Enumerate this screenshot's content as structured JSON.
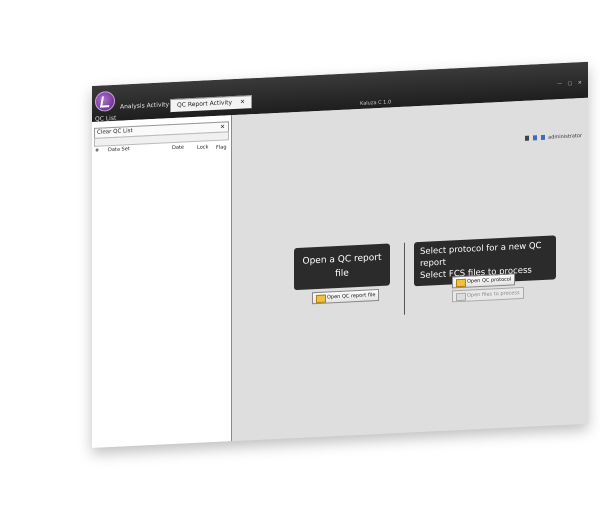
{
  "app": {
    "title": "Kaluza C 1.0"
  },
  "tabs": [
    {
      "label": "Analysis Activity"
    },
    {
      "label": "QC Report Activity",
      "close": "✕"
    }
  ],
  "window_controls": "— ▢ ✕",
  "user": {
    "name": "administrator"
  },
  "left_panel": {
    "header": "QC List",
    "clear_label": "Clear QC List",
    "clear_close": "✕",
    "columns": [
      "#",
      "Data Set",
      "Date",
      "Lock",
      "Flag"
    ]
  },
  "main": {
    "open_heading": "Open a QC report file",
    "new_line1": "Select protocol for a new QC report",
    "new_line2": "Select FCS files to process",
    "open_report_button": "Open QC report file",
    "open_protocol_button": "Open QC protocol",
    "open_files_button": "Open files to process"
  }
}
